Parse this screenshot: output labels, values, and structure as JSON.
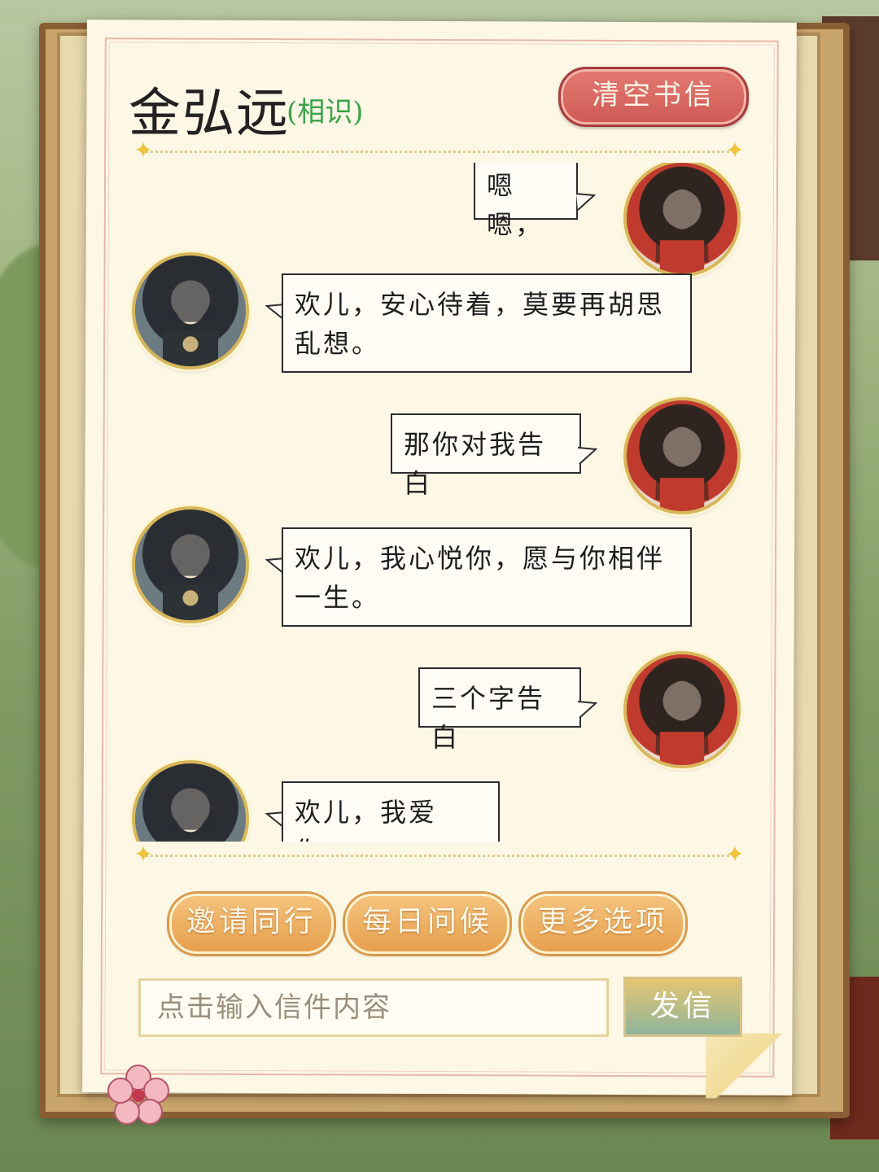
{
  "header": {
    "name": "金弘远",
    "relation": "(相识)",
    "clear_button": "清空书信"
  },
  "messages": [
    {
      "sender": "self",
      "avatar_icon": "female-character-avatar-icon",
      "text": "嗯嗯，"
    },
    {
      "sender": "other",
      "avatar_icon": "male-character-avatar-icon",
      "text": "欢儿，安心待着，莫要再胡思乱想。"
    },
    {
      "sender": "self",
      "avatar_icon": "female-character-avatar-icon",
      "text": "那你对我告白"
    },
    {
      "sender": "other",
      "avatar_icon": "male-character-avatar-icon",
      "text": "欢儿，我心悦你，愿与你相伴一生。"
    },
    {
      "sender": "self",
      "avatar_icon": "female-character-avatar-icon",
      "text": "三个字告白"
    },
    {
      "sender": "other",
      "avatar_icon": "male-character-avatar-icon",
      "text": "欢儿，我爱你。"
    }
  ],
  "actions": {
    "invite": "邀请同行",
    "greet": "每日问候",
    "more": "更多选项"
  },
  "composer": {
    "placeholder": "点击输入信件内容",
    "send": "发信"
  },
  "colors": {
    "relation": "#3aa44a",
    "clear_button": "#cf5a55",
    "action_button": "#e6a04e",
    "paper": "#fdf7e6"
  }
}
